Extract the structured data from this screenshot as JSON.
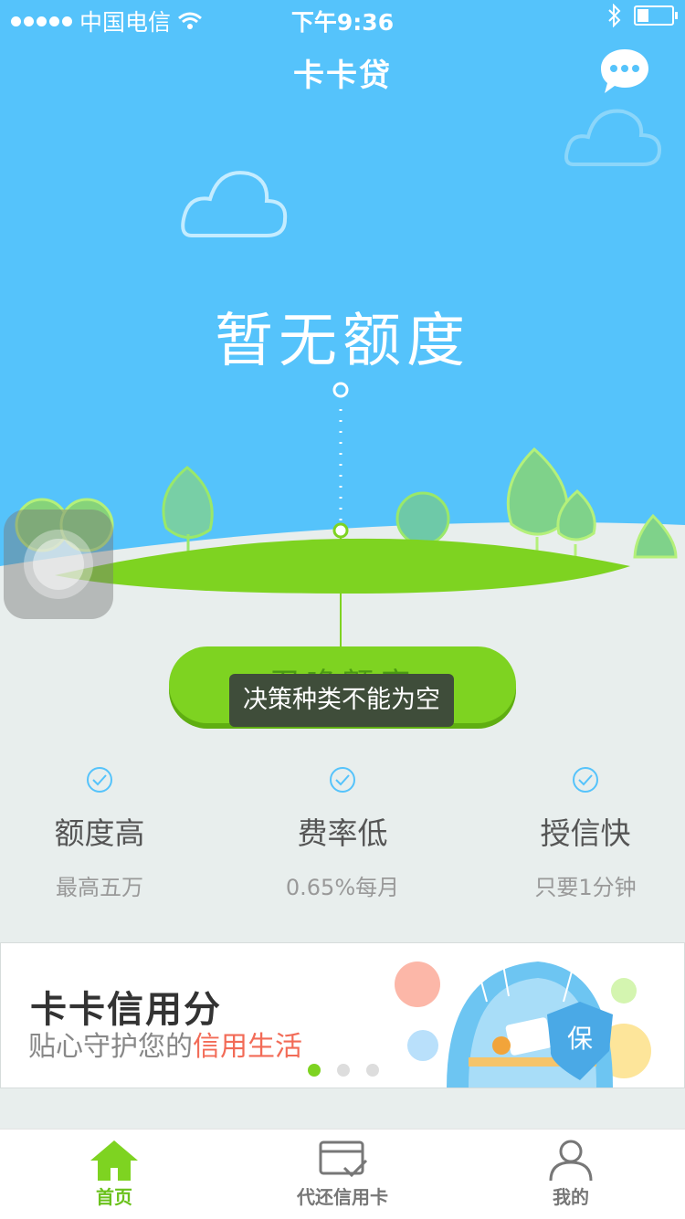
{
  "status_bar": {
    "carrier": "中国电信",
    "time": "下午9:36"
  },
  "header": {
    "title": "卡卡贷",
    "chat_icon": "chat-bubble-icon"
  },
  "hero": {
    "amount_text": "暂无额度"
  },
  "cta": {
    "label": "召唤额度"
  },
  "toast": {
    "message": "决策种类不能为空"
  },
  "features": [
    {
      "title": "额度高",
      "subtitle": "最高五万",
      "icon": "check-circle-icon"
    },
    {
      "title": "费率低",
      "subtitle": "0.65%每月",
      "icon": "check-circle-icon"
    },
    {
      "title": "授信快",
      "subtitle": "只要1分钟",
      "icon": "check-circle-icon"
    }
  ],
  "banner": {
    "title": "卡卡信用分",
    "subtitle_prefix": "贴心守护您的",
    "subtitle_highlight": "信用生活",
    "shield_text": "保",
    "pages": 3,
    "active_page": 1
  },
  "tabs": [
    {
      "label": "首页",
      "icon": "home-icon",
      "active": true
    },
    {
      "label": "代还信用卡",
      "icon": "credit-card-icon",
      "active": false
    },
    {
      "label": "我的",
      "icon": "user-icon",
      "active": false
    }
  ],
  "colors": {
    "sky": "#55c3fb",
    "grass": "#7ed321",
    "accent_text": "#f26b57",
    "active_tab": "#6bc21d"
  }
}
